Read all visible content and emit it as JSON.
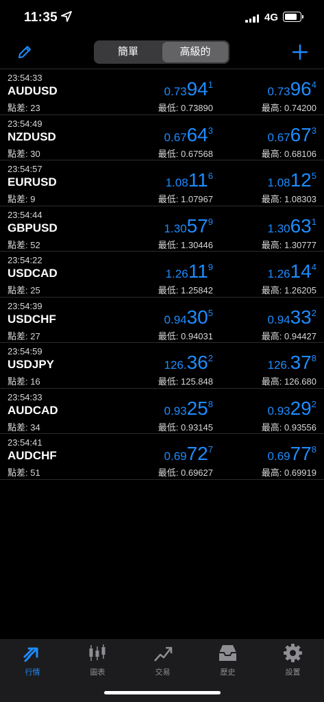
{
  "status_bar": {
    "time": "11:35",
    "network": "4G",
    "battery_level": 0.75
  },
  "toolbar": {
    "segments": [
      "簡單",
      "高級的"
    ],
    "selected_segment": "高級的"
  },
  "colors": {
    "accent": "#1e8cff",
    "background": "#000000",
    "tabbar": "#1c1c1e"
  },
  "quotes": [
    {
      "time": "23:54:33",
      "symbol": "AUDUSD",
      "spread": "點差: 23",
      "bid": {
        "small": "0.73",
        "big": "94",
        "sup": "1"
      },
      "ask": {
        "small": "0.73",
        "big": "96",
        "sup": "4"
      },
      "low": "最低: 0.73890",
      "high": "最高: 0.74200"
    },
    {
      "time": "23:54:49",
      "symbol": "NZDUSD",
      "spread": "點差: 30",
      "bid": {
        "small": "0.67",
        "big": "64",
        "sup": "3"
      },
      "ask": {
        "small": "0.67",
        "big": "67",
        "sup": "3"
      },
      "low": "最低: 0.67568",
      "high": "最高: 0.68106"
    },
    {
      "time": "23:54:57",
      "symbol": "EURUSD",
      "spread": "點差: 9",
      "bid": {
        "small": "1.08",
        "big": "11",
        "sup": "6"
      },
      "ask": {
        "small": "1.08",
        "big": "12",
        "sup": "5"
      },
      "low": "最低: 1.07967",
      "high": "最高: 1.08303"
    },
    {
      "time": "23:54:44",
      "symbol": "GBPUSD",
      "spread": "點差: 52",
      "bid": {
        "small": "1.30",
        "big": "57",
        "sup": "9"
      },
      "ask": {
        "small": "1.30",
        "big": "63",
        "sup": "1"
      },
      "low": "最低: 1.30446",
      "high": "最高: 1.30777"
    },
    {
      "time": "23:54:22",
      "symbol": "USDCAD",
      "spread": "點差: 25",
      "bid": {
        "small": "1.26",
        "big": "11",
        "sup": "9"
      },
      "ask": {
        "small": "1.26",
        "big": "14",
        "sup": "4"
      },
      "low": "最低: 1.25842",
      "high": "最高: 1.26205"
    },
    {
      "time": "23:54:39",
      "symbol": "USDCHF",
      "spread": "點差: 27",
      "bid": {
        "small": "0.94",
        "big": "30",
        "sup": "5"
      },
      "ask": {
        "small": "0.94",
        "big": "33",
        "sup": "2"
      },
      "low": "最低: 0.94031",
      "high": "最高: 0.94427"
    },
    {
      "time": "23:54:59",
      "symbol": "USDJPY",
      "spread": "點差: 16",
      "bid": {
        "small": "126.",
        "big": "36",
        "sup": "2"
      },
      "ask": {
        "small": "126.",
        "big": "37",
        "sup": "8"
      },
      "low": "最低: 125.848",
      "high": "最高: 126.680"
    },
    {
      "time": "23:54:33",
      "symbol": "AUDCAD",
      "spread": "點差: 34",
      "bid": {
        "small": "0.93",
        "big": "25",
        "sup": "8"
      },
      "ask": {
        "small": "0.93",
        "big": "29",
        "sup": "2"
      },
      "low": "最低: 0.93145",
      "high": "最高: 0.93556"
    },
    {
      "time": "23:54:41",
      "symbol": "AUDCHF",
      "spread": "點差: 51",
      "bid": {
        "small": "0.69",
        "big": "72",
        "sup": "7"
      },
      "ask": {
        "small": "0.69",
        "big": "77",
        "sup": "8"
      },
      "low": "最低: 0.69627",
      "high": "最高: 0.69919"
    }
  ],
  "tabs": [
    {
      "label": "行情",
      "icon": "quotes-icon",
      "active": true
    },
    {
      "label": "圖表",
      "icon": "chart-icon",
      "active": false
    },
    {
      "label": "交易",
      "icon": "trade-icon",
      "active": false
    },
    {
      "label": "歷史",
      "icon": "history-icon",
      "active": false
    },
    {
      "label": "設置",
      "icon": "settings-icon",
      "active": false
    }
  ]
}
